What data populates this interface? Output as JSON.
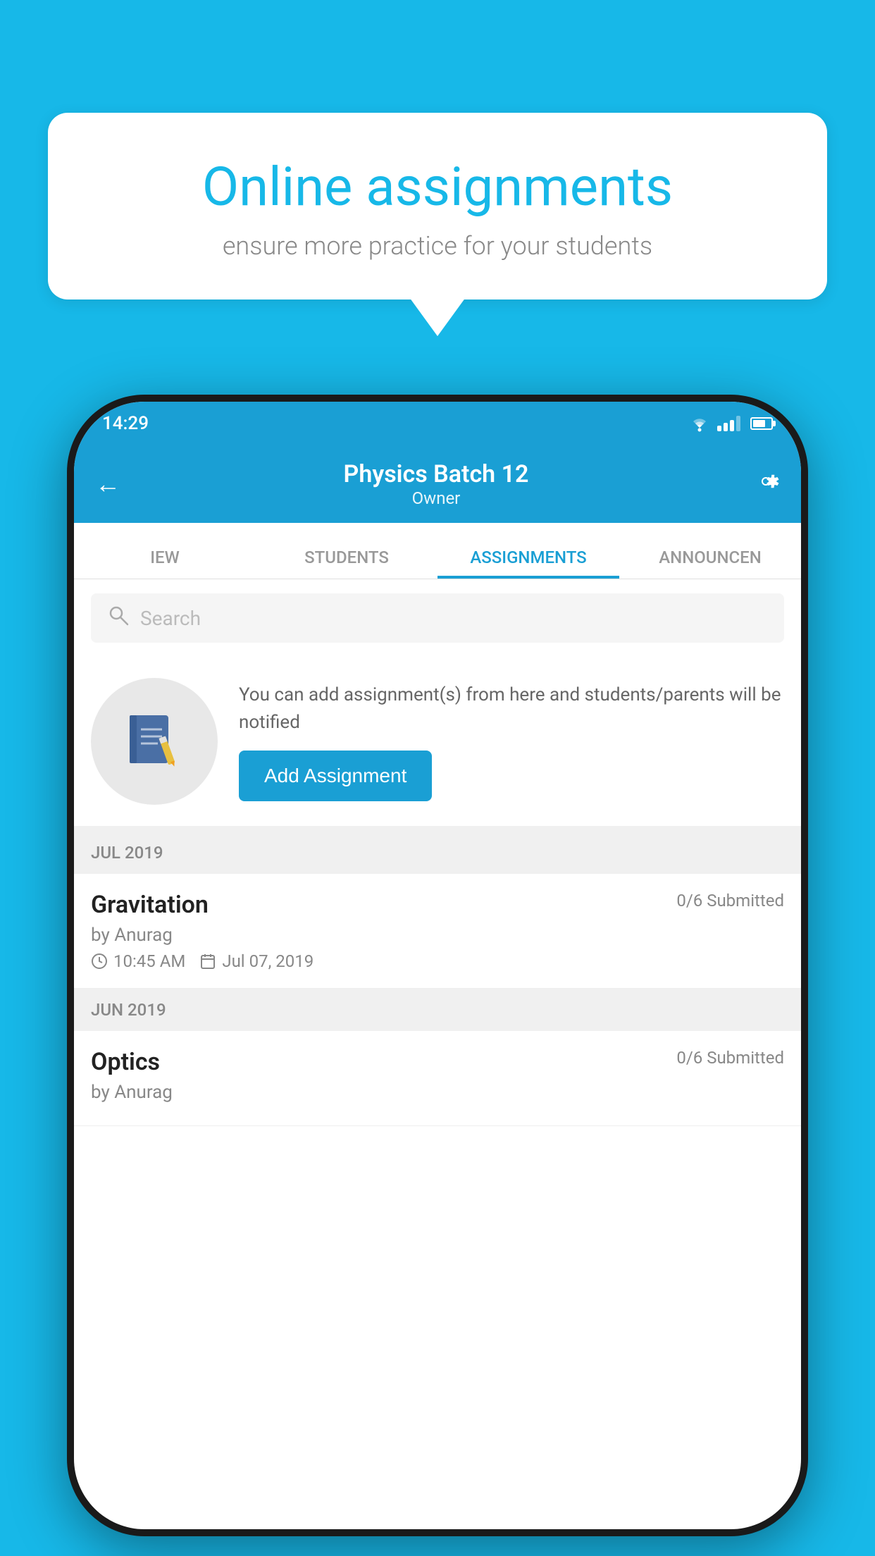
{
  "background_color": "#17b8e8",
  "bubble": {
    "title": "Online assignments",
    "subtitle": "ensure more practice for your students"
  },
  "status_bar": {
    "time": "14:29"
  },
  "header": {
    "title": "Physics Batch 12",
    "subtitle": "Owner",
    "back_label": "←",
    "settings_label": "⚙"
  },
  "tabs": [
    {
      "label": "IEW",
      "active": false
    },
    {
      "label": "STUDENTS",
      "active": false
    },
    {
      "label": "ASSIGNMENTS",
      "active": true
    },
    {
      "label": "ANNOUNCEN",
      "active": false
    }
  ],
  "search": {
    "placeholder": "Search"
  },
  "promo": {
    "text": "You can add assignment(s) from here and students/parents will be notified",
    "button_label": "Add Assignment"
  },
  "month_sections": [
    {
      "label": "JUL 2019",
      "assignments": [
        {
          "name": "Gravitation",
          "submitted": "0/6 Submitted",
          "by": "by Anurag",
          "time": "10:45 AM",
          "date": "Jul 07, 2019"
        }
      ]
    },
    {
      "label": "JUN 2019",
      "assignments": [
        {
          "name": "Optics",
          "submitted": "0/6 Submitted",
          "by": "by Anurag",
          "time": "",
          "date": ""
        }
      ]
    }
  ]
}
